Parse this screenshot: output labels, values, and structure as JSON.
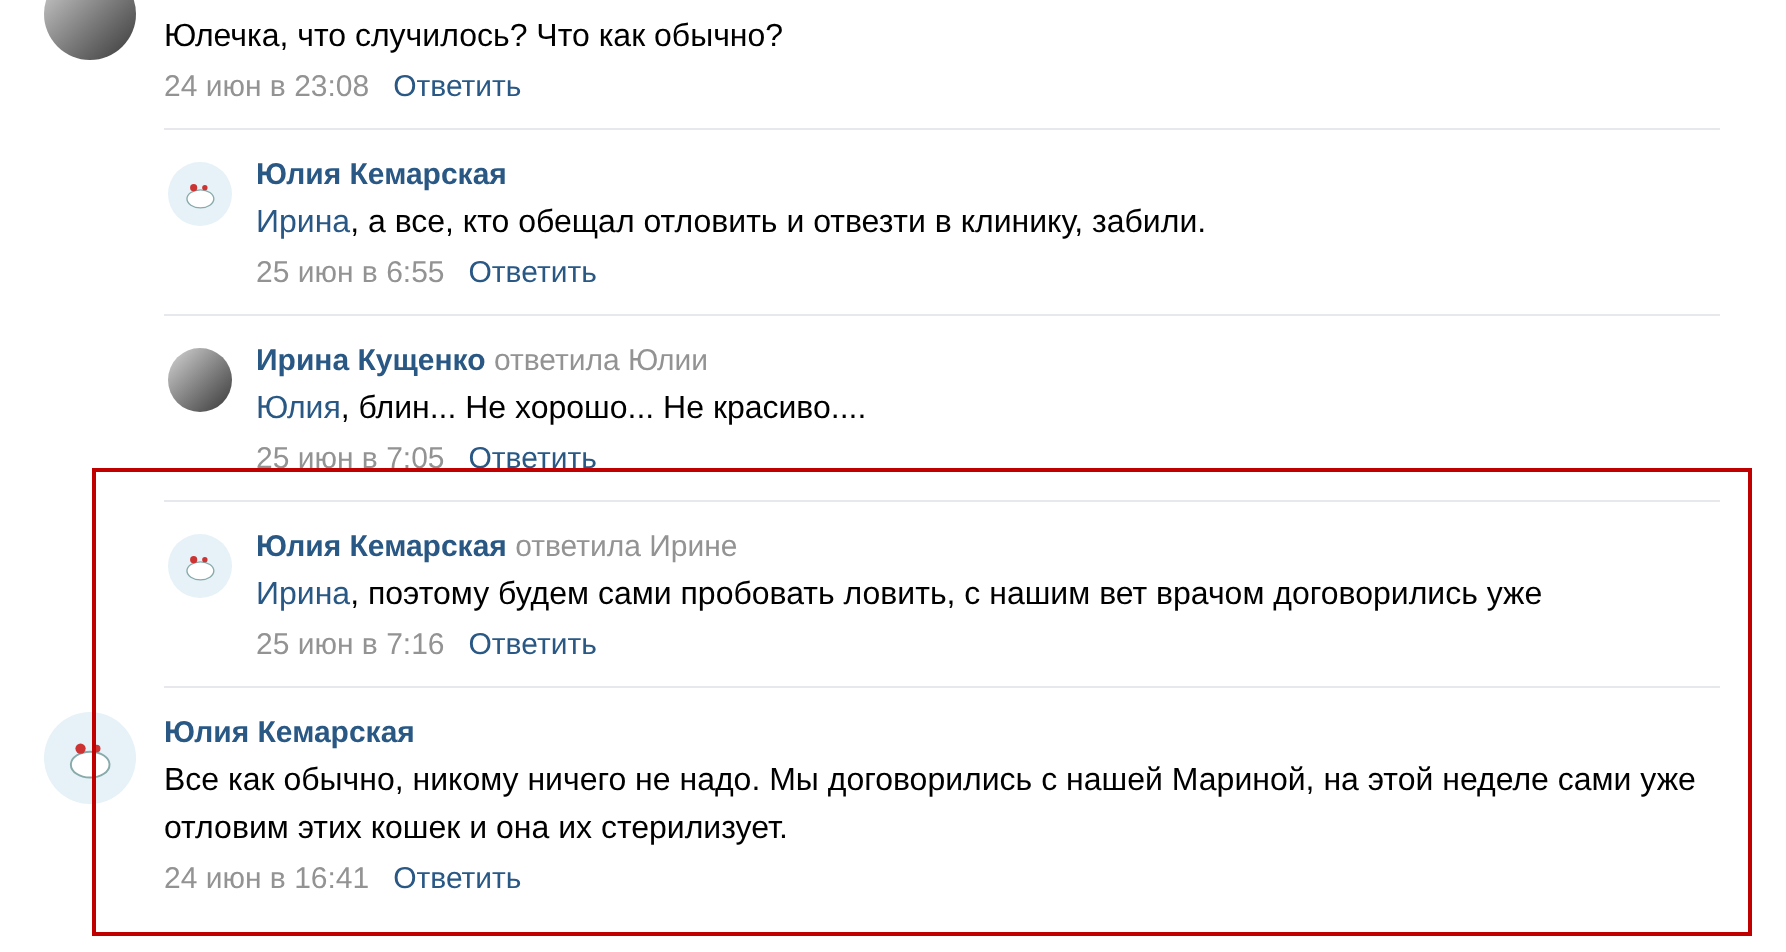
{
  "comments": [
    {
      "avatar": {
        "kind": "photo"
      },
      "text": "Юлечка, что случилось? Что как обычно?",
      "date": "24 июн в 23:08",
      "reply_label": "Ответить",
      "replies": [
        {
          "author": "Юлия Кемарская",
          "avatar": {
            "kind": "logo"
          },
          "mention": "Ирина",
          "text": ", а все, кто обещал отловить и отвезти в клинику, забили.",
          "date": "25 июн в 6:55",
          "reply_label": "Ответить"
        },
        {
          "author": "Ирина Кущенко",
          "reply_to": "ответила Юлии",
          "avatar": {
            "kind": "photo"
          },
          "mention": "Юлия",
          "text": ", блин... Не хорошо... Не красиво....",
          "date": "25 июн в 7:05",
          "reply_label": "Ответить"
        },
        {
          "author": "Юлия Кемарская",
          "reply_to": "ответила Ирине",
          "avatar": {
            "kind": "logo"
          },
          "mention": "Ирина",
          "text": ", поэтому будем сами пробовать ловить, с нашим вет врачом договорились уже",
          "date": "25 июн в 7:16",
          "reply_label": "Ответить"
        }
      ]
    },
    {
      "author": "Юлия Кемарская",
      "avatar": {
        "kind": "logo"
      },
      "text": "Все как обычно, никому ничего не надо. Мы договорились с нашей Мариной, на этой неделе сами уже отловим этих кошек и она их стерилизует.",
      "date": "24 июн в 16:41",
      "reply_label": "Ответить"
    }
  ]
}
